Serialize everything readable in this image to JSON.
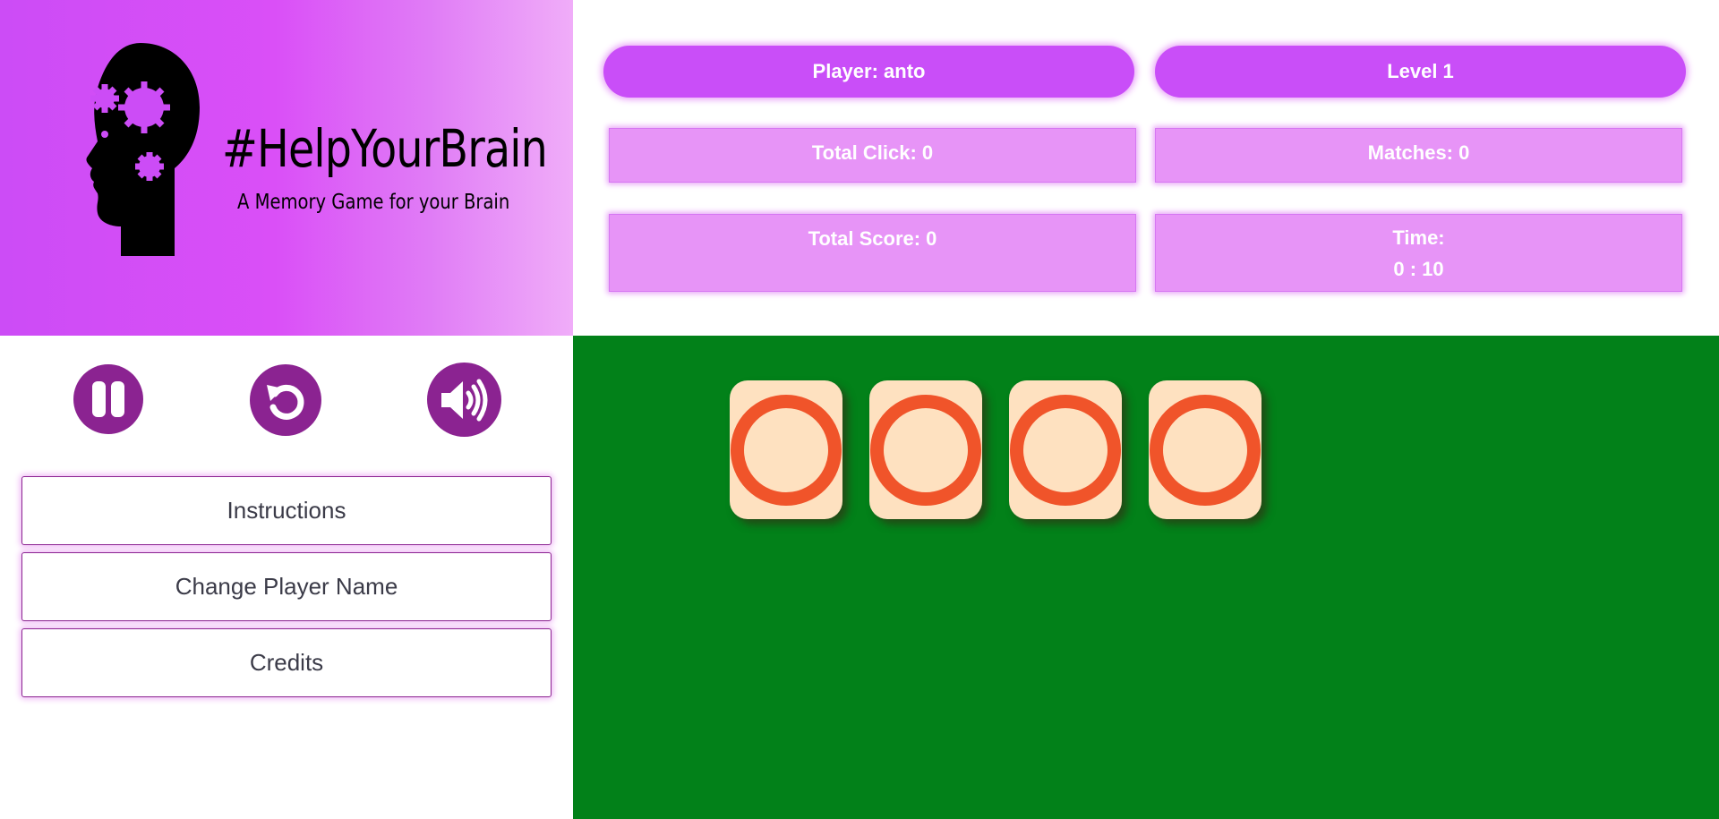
{
  "logo": {
    "title": "#HelpYourBrain",
    "subtitle": "A Memory Game for your Brain",
    "icon": "head-with-gears-icon"
  },
  "stats": {
    "player": "Player: anto",
    "level": "Level 1",
    "total_click": "Total Click: 0",
    "matches": "Matches: 0",
    "total_score": "Total Score: 0",
    "time_label": "Time:",
    "time_value": "0 : 10"
  },
  "controls": {
    "pause_icon": "pause-icon",
    "restart_icon": "restart-icon",
    "sound_icon": "volume-icon"
  },
  "menu": {
    "instructions": "Instructions",
    "change_player_name": "Change Player Name",
    "credits": "Credits"
  },
  "board": {
    "background": "#028119",
    "cards": [
      {
        "symbol": "O",
        "state": "face-up"
      },
      {
        "symbol": "O",
        "state": "face-up"
      },
      {
        "symbol": "O",
        "state": "face-up"
      },
      {
        "symbol": "O",
        "state": "face-up"
      }
    ]
  },
  "colors": {
    "primary_purple": "#c94ef8",
    "stat_box": "#e794f7",
    "control_button": "#8b2391",
    "card_face": "#fee1c0",
    "card_symbol": "#f0542a"
  }
}
